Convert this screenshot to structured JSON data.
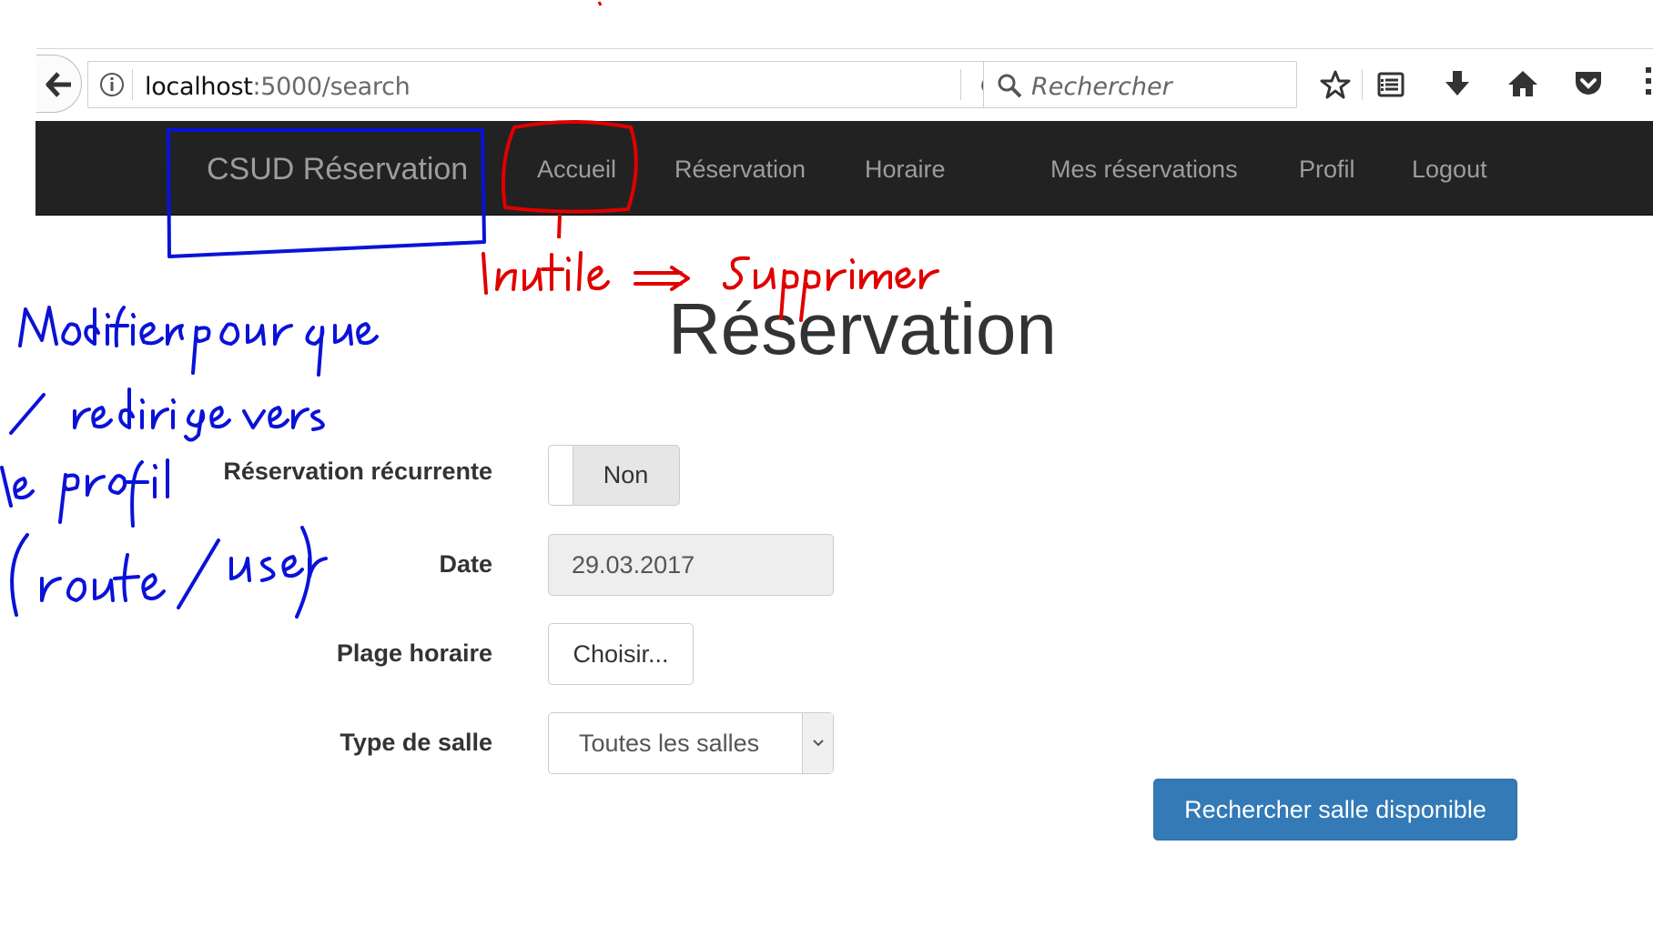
{
  "browser": {
    "url_host": "localhost",
    "url_rest": ":5000/search",
    "search_placeholder": "Rechercher",
    "icons": [
      "back-arrow-icon",
      "info-icon",
      "reload-icon",
      "search-icon",
      "star-icon",
      "reading-list-icon",
      "download-icon",
      "home-icon",
      "pocket-icon",
      "menu-icon"
    ]
  },
  "navbar": {
    "brand": "CSUD Réservation",
    "links": [
      "Accueil",
      "Réservation",
      "Horaire",
      "Mes réservations",
      "Profil",
      "Logout"
    ],
    "background": "#222222",
    "link_color": "#9d9d9d"
  },
  "page": {
    "title": "Réservation"
  },
  "form": {
    "recurring_label": "Réservation récurrente",
    "recurring_value": "Non",
    "date_label": "Date",
    "date_value": "29.03.2017",
    "timeslot_label": "Plage horaire",
    "timeslot_button": "Choisir...",
    "roomtype_label": "Type de salle",
    "roomtype_value": "Toutes les salles",
    "submit_label": "Rechercher salle disponible",
    "submit_color": "#337ab7"
  },
  "annotations": {
    "blue_color": "#0a12d8",
    "red_color": "#e00000"
  }
}
